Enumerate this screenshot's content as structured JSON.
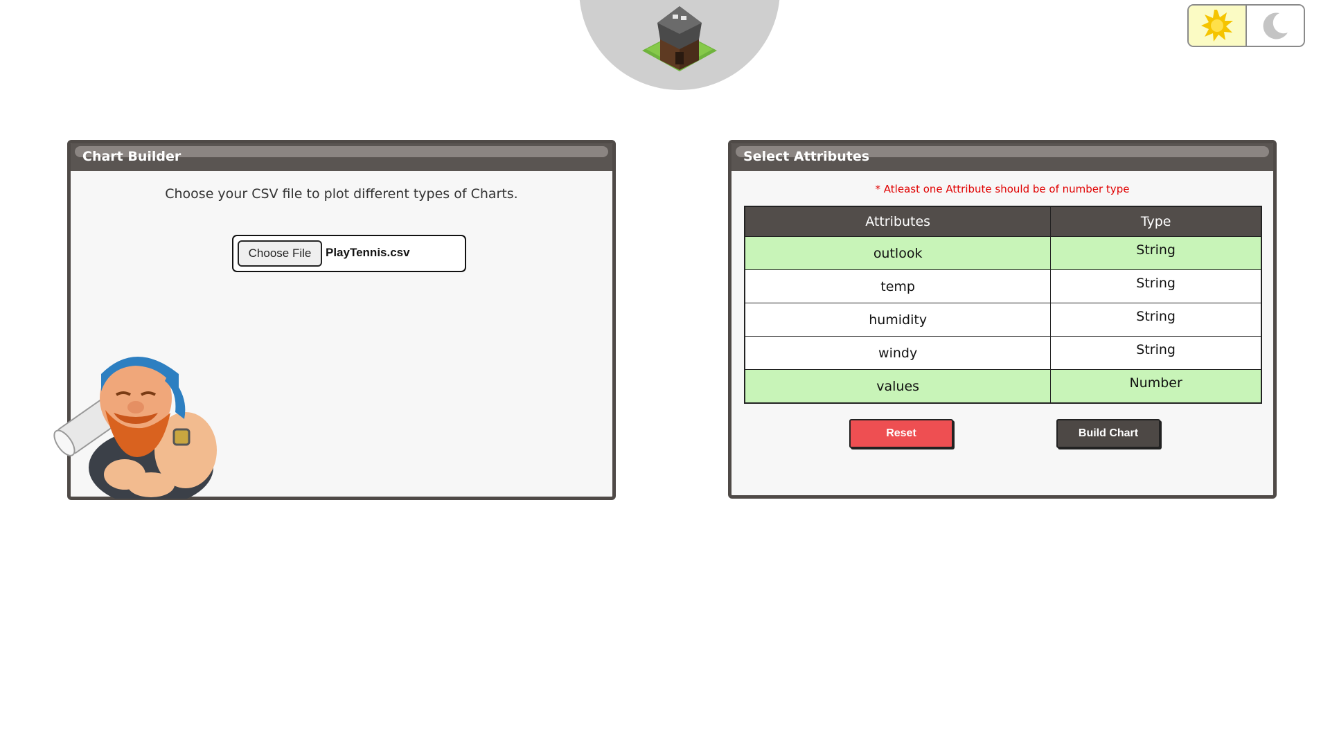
{
  "theme": {
    "light_icon": "sun-icon",
    "dark_icon": "moon-icon",
    "active": "light"
  },
  "logo": {
    "icon": "builder-hut-icon"
  },
  "chart_builder": {
    "title": "Chart Builder",
    "intro": "Choose your CSV file to plot different types of Charts.",
    "file_button_label": "Choose File",
    "file_name": "PlayTennis.csv",
    "mascot_icon": "builder-mascot-icon"
  },
  "select_attributes": {
    "title": "Select Attributes",
    "warning": "* Atleast one Attribute should be of number type",
    "columns": [
      "Attributes",
      "Type"
    ],
    "rows": [
      {
        "name": "outlook",
        "type": "String",
        "selected": true
      },
      {
        "name": "temp",
        "type": "String",
        "selected": false
      },
      {
        "name": "humidity",
        "type": "String",
        "selected": false
      },
      {
        "name": "windy",
        "type": "String",
        "selected": false
      },
      {
        "name": "values",
        "type": "Number",
        "selected": true
      }
    ],
    "reset_label": "Reset",
    "build_label": "Build Chart"
  },
  "colors": {
    "selected_row": "#c8f4b8",
    "header_bg": "#524d4a",
    "reset_btn": "#ee4f52",
    "build_btn": "#4d4845",
    "warning_text": "#e00000"
  }
}
